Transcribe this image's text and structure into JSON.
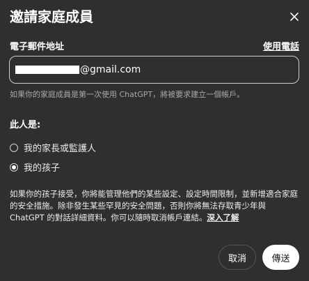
{
  "dialog": {
    "title": "邀請家庭成員",
    "close_icon": "close-icon",
    "email_label": "電子郵件地址",
    "use_phone_link": "使用電話",
    "email_value_suffix": "@gmail.com",
    "hint": "如果你的家庭成員是第一次使用 ChatGPT，將被要求建立一個帳戶。",
    "relation_label": "此人是:",
    "options": [
      {
        "label": "我的家長或監護人",
        "selected": false
      },
      {
        "label": "我的孩子",
        "selected": true
      }
    ],
    "description": "如果你的孩子接受，你將能管理他們的某些設定、設定時間限制，並新增適合家庭的安全措施。除非發生某些罕見的安全問題，否則你將無法存取青少年與 ChatGPT 的對話詳細資料。你可以隨時取消帳戶連結。",
    "learn_more": "深入了解",
    "cancel_label": "取消",
    "send_label": "傳送"
  },
  "colors": {
    "background": "#2f2f2f",
    "text": "#ececec",
    "muted": "#a8a8a8",
    "primary_button": "#ffffff"
  }
}
